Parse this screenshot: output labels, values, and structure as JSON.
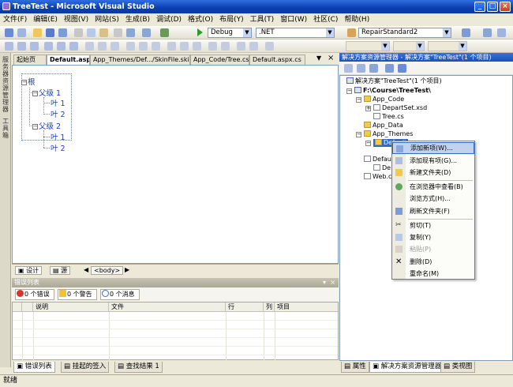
{
  "window": {
    "title": "TreeTest - Microsoft Visual Studio"
  },
  "menu": [
    "文件(F)",
    "编辑(E)",
    "视图(V)",
    "网站(S)",
    "生成(B)",
    "调试(D)",
    "格式(O)",
    "布局(Y)",
    "工具(T)",
    "窗口(W)",
    "社区(C)",
    "帮助(H)"
  ],
  "toolbar": {
    "config": "Debug",
    "platform": ".NET",
    "repair": "RepairStandard2"
  },
  "left_sidebar": {
    "solution_explorer": "服务器资源管理器",
    "toolbox": "工具箱"
  },
  "doc_tabs": [
    "起始页",
    "Default.aspx",
    "App_Themes/Def.../SkinFile.skin",
    "App_Code/Tree.cs",
    "Default.aspx.cs"
  ],
  "tree": {
    "root": "根",
    "parent1": "父级 1",
    "leaf1": "叶 1",
    "leaf2": "叶 2",
    "parent2": "父级 2",
    "leaf3": "叶 1",
    "leaf4": "叶 2"
  },
  "editor_status": {
    "design": "设计",
    "source": "源",
    "body_tag": "<body>"
  },
  "error_list": {
    "title": "错误列表",
    "errors": "0 个错误",
    "warnings": "0 个警告",
    "messages": "0 个消息",
    "columns": [
      "说明",
      "文件",
      "行",
      "列",
      "项目"
    ]
  },
  "bottom_tabs": [
    "错误列表",
    "挂起的签入",
    "查找结果 1"
  ],
  "status": "就绪",
  "solution_explorer": {
    "title": "解决方案资源管理器 - 解决方案\"TreeTest\"(1 个项目)",
    "solution": "解决方案\"TreeTest\"(1 个项目)",
    "project": "F:\\Course\\TreeTest\\",
    "app_code": "App_Code",
    "departset": "DepartSet.xsd",
    "tree_cs": "Tree.cs",
    "app_data": "App_Data",
    "app_themes": "App_Themes",
    "default_folder": "Default",
    "default_item": "Defau",
    "default_sub": "De",
    "web_config": "Web.c"
  },
  "context_menu": [
    {
      "label": "添加新项(W)...",
      "enabled": true
    },
    {
      "label": "添加现有项(G)...",
      "enabled": true
    },
    {
      "label": "新建文件夹(D)",
      "enabled": true
    },
    {
      "label": "在浏览器中查看(B)",
      "enabled": true
    },
    {
      "label": "浏览方式(H)...",
      "enabled": true
    },
    {
      "label": "刷新文件夹(F)",
      "enabled": true
    },
    {
      "label": "剪切(T)",
      "enabled": true
    },
    {
      "label": "复制(Y)",
      "enabled": true
    },
    {
      "label": "粘贴(P)",
      "enabled": false
    },
    {
      "label": "删除(D)",
      "enabled": true
    },
    {
      "label": "重命名(M)",
      "enabled": true
    }
  ],
  "right_bottom_tabs": [
    "属性",
    "解决方案资源管理器",
    "类视图"
  ]
}
